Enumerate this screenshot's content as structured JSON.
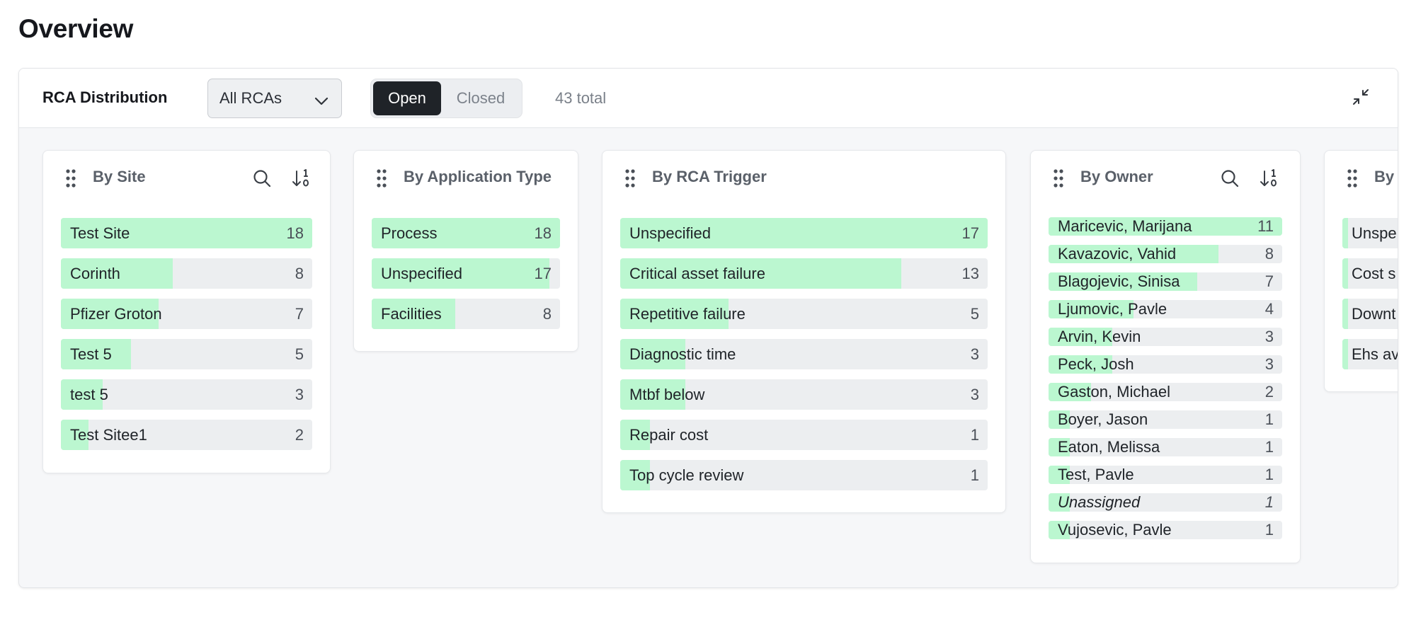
{
  "page": {
    "title": "Overview"
  },
  "toolbar": {
    "title": "RCA Distribution",
    "filter_value": "All RCAs",
    "status_tabs": [
      {
        "label": "Open",
        "active": true
      },
      {
        "label": "Closed",
        "active": false
      }
    ],
    "total_text": "43 total"
  },
  "colors": {
    "bar_fill": "#bbf7d0",
    "bar_track": "#eceef0",
    "active_tab": "#1f2328"
  },
  "cards": [
    {
      "title": "By Site",
      "icons": [
        "search-icon",
        "sort-icon"
      ],
      "rows": [
        {
          "label": "Test Site",
          "count": 18
        },
        {
          "label": "Corinth",
          "count": 8
        },
        {
          "label": "Pfizer Groton",
          "count": 7
        },
        {
          "label": "Test 5",
          "count": 5
        },
        {
          "label": "test 5",
          "count": 3
        },
        {
          "label": "Test Sitee1",
          "count": 2
        }
      ]
    },
    {
      "title": "By Application Type",
      "icons": [],
      "rows": [
        {
          "label": "Process",
          "count": 18
        },
        {
          "label": "Unspecified",
          "count": 17
        },
        {
          "label": "Facilities",
          "count": 8
        }
      ]
    },
    {
      "title": "By RCA Trigger",
      "icons": [],
      "rows": [
        {
          "label": "Unspecified",
          "count": 17
        },
        {
          "label": "Critical asset failure",
          "count": 13
        },
        {
          "label": "Repetitive failure",
          "count": 5
        },
        {
          "label": "Diagnostic time",
          "count": 3
        },
        {
          "label": "Mtbf below",
          "count": 3
        },
        {
          "label": "Repair cost",
          "count": 1
        },
        {
          "label": "Top cycle review",
          "count": 1
        }
      ]
    },
    {
      "title": "By Owner",
      "icons": [
        "search-icon",
        "sort-icon"
      ],
      "rows": [
        {
          "label": "Maricevic, Marijana",
          "count": 11
        },
        {
          "label": "Kavazovic, Vahid",
          "count": 8
        },
        {
          "label": "Blagojevic, Sinisa",
          "count": 7
        },
        {
          "label": "Ljumovic, Pavle",
          "count": 4
        },
        {
          "label": "Arvin, Kevin",
          "count": 3
        },
        {
          "label": "Peck, Josh",
          "count": 3
        },
        {
          "label": "Gaston, Michael",
          "count": 2
        },
        {
          "label": "Boyer, Jason",
          "count": 1
        },
        {
          "label": "Eaton, Melissa",
          "count": 1
        },
        {
          "label": "Test, Pavle",
          "count": 1
        },
        {
          "label": "Unassigned",
          "count": 1,
          "italic": true
        },
        {
          "label": "Vujosevic, Pavle",
          "count": 1
        }
      ]
    },
    {
      "title": "By",
      "icons": [],
      "rows": [
        {
          "label": "Unspe",
          "fill": 0.07
        },
        {
          "label": "Cost s",
          "fill": 0.07
        },
        {
          "label": "Downt",
          "fill": 0.07
        },
        {
          "label": "Ehs av",
          "fill": 0.07
        }
      ]
    }
  ]
}
